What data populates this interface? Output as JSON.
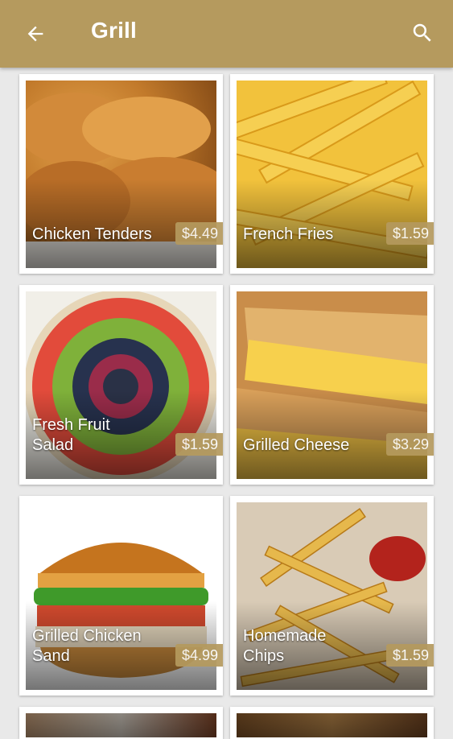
{
  "appbar": {
    "title": "Grill",
    "back_icon": "arrow-left-icon",
    "search_icon": "search-icon",
    "color": "#b59a5e"
  },
  "items": [
    {
      "name": "Chicken Tenders",
      "price": "$4.49"
    },
    {
      "name": "French Fries",
      "price": "$1.59"
    },
    {
      "name": "Fresh Fruit Salad",
      "price": "$1.59"
    },
    {
      "name": "Grilled Cheese",
      "price": "$3.29"
    },
    {
      "name": "Grilled Chicken Sand",
      "price": "$4.99"
    },
    {
      "name": "Homemade Chips",
      "price": "$1.59"
    }
  ]
}
